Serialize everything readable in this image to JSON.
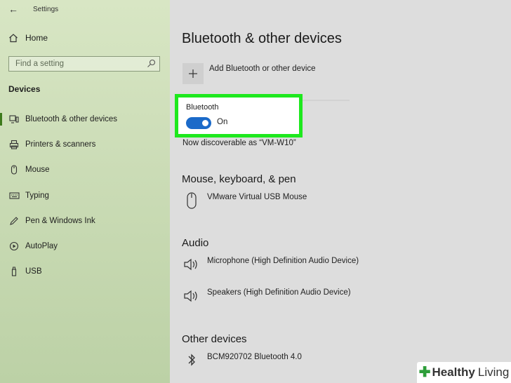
{
  "window": {
    "title": "Settings"
  },
  "sidebar": {
    "home_label": "Home",
    "search_placeholder": "Find a setting",
    "section_label": "Devices",
    "items": [
      {
        "label": "Bluetooth & other devices",
        "icon": "bluetooth-devices-icon",
        "active": true
      },
      {
        "label": "Printers & scanners",
        "icon": "printer-icon"
      },
      {
        "label": "Mouse",
        "icon": "mouse-icon"
      },
      {
        "label": "Typing",
        "icon": "keyboard-icon"
      },
      {
        "label": "Pen & Windows Ink",
        "icon": "pen-icon"
      },
      {
        "label": "AutoPlay",
        "icon": "autoplay-icon"
      },
      {
        "label": "USB",
        "icon": "usb-icon"
      }
    ]
  },
  "main": {
    "title": "Bluetooth & other devices",
    "add_label": "Add Bluetooth or other device",
    "bluetooth": {
      "label": "Bluetooth",
      "state": "On",
      "enabled": true,
      "discoverable": "Now discoverable as “VM-W10”"
    },
    "sections": {
      "input": {
        "title": "Mouse, keyboard, & pen",
        "devices": [
          "VMware Virtual USB Mouse"
        ]
      },
      "audio": {
        "title": "Audio",
        "devices": [
          "Microphone (High Definition Audio Device)",
          "Speakers (High Definition Audio Device)"
        ]
      },
      "other": {
        "title": "Other devices",
        "devices": [
          "BCM920702 Bluetooth 4.0"
        ]
      }
    }
  },
  "watermark": {
    "bold": "Healthy",
    "light": "Living"
  },
  "colors": {
    "highlight": "#1ee81e",
    "toggle_on": "#1b6ac9",
    "sidebar_tint": "#cbdcb6",
    "active_indicator": "#3d7a1c"
  }
}
